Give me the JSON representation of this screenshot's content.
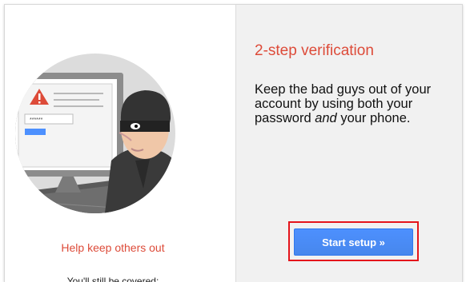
{
  "left": {
    "caption": "Help keep others out",
    "subcaption": "You'll still be covered:"
  },
  "right": {
    "title": "2-step verification",
    "desc_part1": "Keep the bad guys out of your account by using both your password ",
    "desc_em": "and",
    "desc_part2": " your phone.",
    "button_label": "Start setup »"
  },
  "illustration": {
    "password_mask": "******",
    "icons": [
      "monitor-icon",
      "warning-icon",
      "burglar-icon"
    ]
  },
  "colors": {
    "accent_red": "#dd4b39",
    "button_blue": "#4d90fe",
    "highlight_red": "#e4141b"
  }
}
